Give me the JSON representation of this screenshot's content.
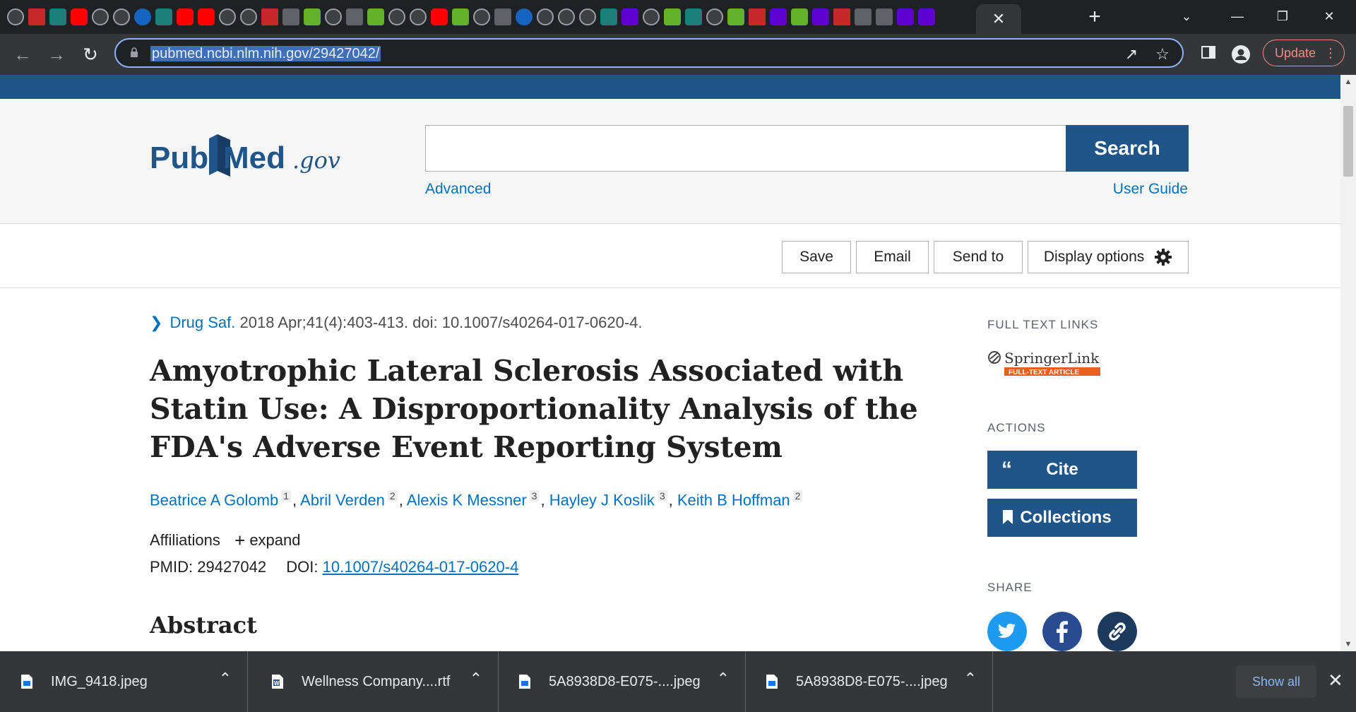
{
  "browser": {
    "tab_favicons": [
      "globe",
      "pinwheel",
      "stat",
      "youtube",
      "globe",
      "globe",
      "jn",
      "teal-tree",
      "youtube",
      "youtube",
      "globe",
      "globe",
      "b",
      "dark",
      "play",
      "teal-heart",
      "dark",
      "play",
      "photo",
      "globe",
      "youtube",
      "play",
      "globe",
      "dark",
      "search",
      "globe",
      "globe",
      "globe",
      "teal-tree",
      "yahoo",
      "globe",
      "play",
      "teal-tree",
      "globe",
      "g",
      "bookmark",
      "yahoo",
      "play",
      "yahoo",
      "b",
      "dark",
      "ul",
      "yahoo",
      "mail",
      "active",
      "teal-heart",
      "red",
      "globe"
    ],
    "active_tab_close": "✕",
    "new_tab": "+",
    "window_controls": [
      "⌄",
      "—",
      "❐",
      "✕"
    ],
    "url": "pubmed.ncbi.nlm.nih.gov/29427042/",
    "update_label": "Update",
    "update_menu": "⋮"
  },
  "header": {
    "logo": {
      "pub": "Pub",
      "med": "Med",
      "gov": ".gov"
    },
    "search_placeholder": "",
    "search_button": "Search",
    "advanced": "Advanced",
    "user_guide": "User Guide"
  },
  "actions_bar": {
    "save": "Save",
    "email": "Email",
    "send_to": "Send to",
    "display_options": "Display options"
  },
  "article": {
    "journal": "Drug Saf.",
    "citation": "2018 Apr;41(4):403-413. doi: 10.1007/s40264-017-0620-4.",
    "title": "Amyotrophic Lateral Sclerosis Associated with Statin Use: A Disproportionality Analysis of the FDA's Adverse Event Reporting System",
    "authors": [
      {
        "name": "Beatrice A Golomb",
        "aff": "1"
      },
      {
        "name": "Abril Verden",
        "aff": "2"
      },
      {
        "name": "Alexis K Messner",
        "aff": "3"
      },
      {
        "name": "Hayley J Koslik",
        "aff": "3"
      },
      {
        "name": "Keith B Hoffman",
        "aff": "2"
      }
    ],
    "affiliations_label": "Affiliations",
    "expand_label": "expand",
    "pmid_label": "PMID:",
    "pmid": "29427042",
    "doi_label": "DOI:",
    "doi": "10.1007/s40264-017-0620-4",
    "abstract_heading": "Abstract"
  },
  "sidebar": {
    "full_text_heading": "FULL TEXT LINKS",
    "springer_name": "SpringerLink",
    "springer_sub": "FULL-TEXT ARTICLE",
    "actions_heading": "ACTIONS",
    "cite": "Cite",
    "collections": "Collections",
    "share_heading": "SHARE",
    "share_icons": [
      "twitter-icon",
      "facebook-icon",
      "link-icon"
    ]
  },
  "downloads": {
    "items": [
      {
        "name": "IMG_9418.jpeg"
      },
      {
        "name": "Wellness Company....rtf"
      },
      {
        "name": "5A8938D8-E075-....jpeg"
      },
      {
        "name": "5A8938D8-E075-....jpeg"
      }
    ],
    "show_all": "Show all",
    "close": "✕"
  },
  "colors": {
    "pubmed_blue": "#20558a",
    "link_blue": "#0071bc",
    "chrome_dark": "#202124",
    "chrome_toolbar": "#35363a"
  }
}
